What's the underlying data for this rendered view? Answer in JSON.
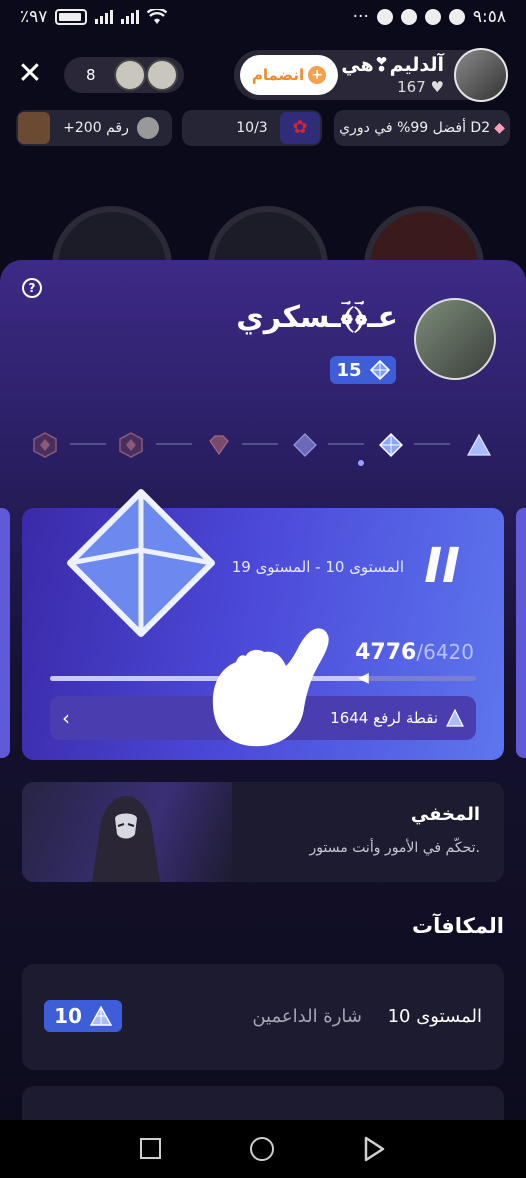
{
  "status_bar": {
    "battery": "٪٩٧",
    "time": "٩:٥٨",
    "dots": "···"
  },
  "room": {
    "viewer_count": "8",
    "host_name": "آلدليم❣هي",
    "host_likes": "167",
    "join_label": "انضمام",
    "rank_chip": "+200 رقم",
    "progress_chip": "10/3",
    "league_chip": "أفضل 99% في دوري D2"
  },
  "panel": {
    "user_name": "عـ﴿ؔ﴾ؔـسكري",
    "user_level": "15",
    "level_card": {
      "tier_roman": "II",
      "range": "المستوى 10 - المستوى 19",
      "points_current": "4776",
      "points_total": "6420",
      "progress": 0.744,
      "hint": "1644 نقطة لرفع"
    },
    "mask_card": {
      "title": "المخفي",
      "subtitle": "تحكّم في الأمور وأنت مستور."
    },
    "rewards_title": "المكافآت",
    "reward": {
      "level": "المستوى 10",
      "name": "شارة الداعمين",
      "badge": "10"
    }
  },
  "colors": {
    "accent_blue": "#3d5ed8",
    "join_orange": "#f28a2b",
    "panel_purple": "#3d2a86"
  }
}
